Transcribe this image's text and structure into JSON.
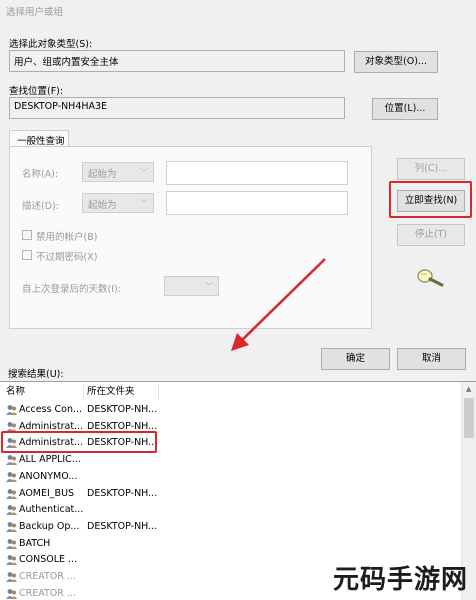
{
  "window": {
    "title": "选择用户或组"
  },
  "object_type": {
    "label": "选择此对象类型(S):",
    "value": "用户、组或内置安全主体",
    "button": "对象类型(O)..."
  },
  "location": {
    "label": "查找位置(F):",
    "value": "DESKTOP-NH4HA3E",
    "button": "位置(L)..."
  },
  "query_tab": {
    "title": "一般性查询",
    "name_label": "名称(A):",
    "name_mode": "起始为",
    "desc_label": "描述(D):",
    "desc_mode": "起始为",
    "disabled_accounts": "禁用的帐户(B)",
    "non_expiring_pw": "不过期密码(X)",
    "days_label": "自上次登录后的天数(I):"
  },
  "side_buttons": {
    "columns": "列(C)...",
    "find_now": "立即查找(N)",
    "stop": "停止(T)"
  },
  "dialog_buttons": {
    "ok": "确定",
    "cancel": "取消"
  },
  "results": {
    "label": "搜索结果(U):",
    "columns": [
      "名称",
      "所在文件夹"
    ],
    "rows": [
      {
        "name": "Access Con...",
        "folder": "DESKTOP-NH..."
      },
      {
        "name": "Administrat...",
        "folder": "DESKTOP-NH..."
      },
      {
        "name": "Administrat...",
        "folder": "DESKTOP-NH..."
      },
      {
        "name": "ALL APPLIC...",
        "folder": ""
      },
      {
        "name": "ANONYMO...",
        "folder": ""
      },
      {
        "name": "AOMEI_BUS",
        "folder": "DESKTOP-NH..."
      },
      {
        "name": "Authenticat...",
        "folder": ""
      },
      {
        "name": "Backup Op...",
        "folder": "DESKTOP-NH..."
      },
      {
        "name": "BATCH",
        "folder": ""
      },
      {
        "name": "CONSOLE ...",
        "folder": ""
      },
      {
        "name": "CREATOR ...",
        "folder": ""
      },
      {
        "name": "CREATOR ...",
        "folder": ""
      }
    ]
  },
  "watermark": {
    "text": "元码手游网"
  },
  "colors": {
    "highlight": "#d9272d",
    "background": "#f0f0f0"
  }
}
